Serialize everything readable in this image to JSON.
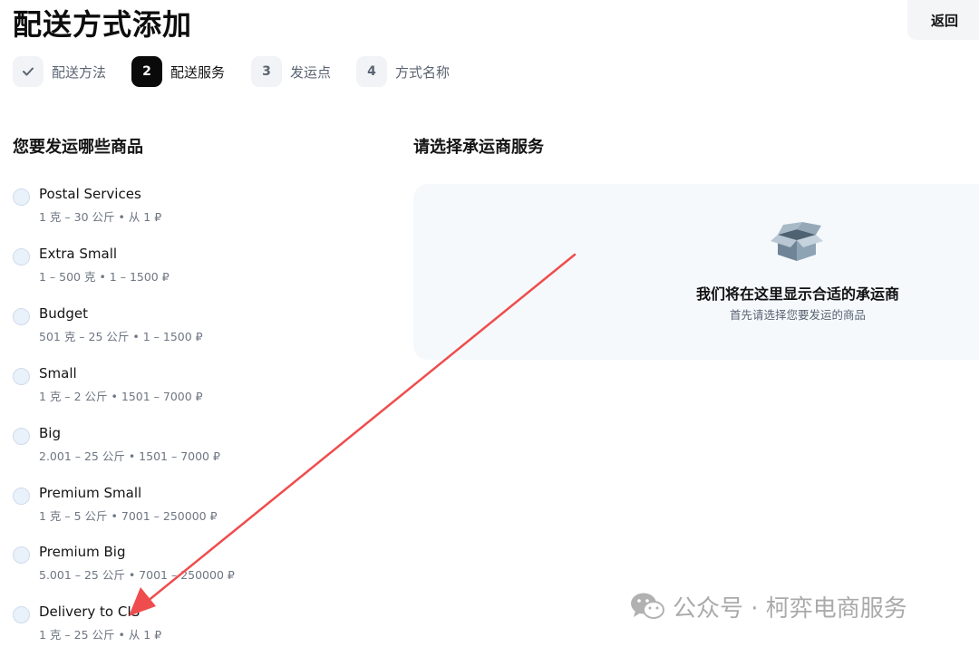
{
  "header": {
    "title": "配送方式添加",
    "back_label": "返回"
  },
  "steps": [
    {
      "badge": "✓",
      "label": "配送方法",
      "state": "done"
    },
    {
      "badge": "2",
      "label": "配送服务",
      "state": "active"
    },
    {
      "badge": "3",
      "label": "发运点",
      "state": "pending"
    },
    {
      "badge": "4",
      "label": "方式名称",
      "state": "pending"
    }
  ],
  "products": {
    "title": "您要发运哪些商品",
    "items": [
      {
        "name": "Postal Services",
        "meta": "1 克 – 30 公斤 • 从 1 ₽"
      },
      {
        "name": "Extra Small",
        "meta": "1 – 500 克 • 1 – 1500 ₽"
      },
      {
        "name": "Budget",
        "meta": "501 克 – 25 公斤 • 1 – 1500 ₽"
      },
      {
        "name": "Small",
        "meta": "1 克 – 2 公斤 • 1501 – 7000 ₽"
      },
      {
        "name": "Big",
        "meta": "2.001 – 25 公斤 • 1501 – 7000 ₽"
      },
      {
        "name": "Premium Small",
        "meta": "1 克 – 5 公斤 • 7001 – 250000 ₽"
      },
      {
        "name": "Premium Big",
        "meta": "5.001 – 25 公斤 • 7001 – 250000 ₽"
      },
      {
        "name": "Delivery to CIS",
        "meta": "1 克 – 25 公斤 • 从 1 ₽"
      }
    ]
  },
  "carrier": {
    "title": "请选择承运商服务",
    "empty_title": "我们将在这里显示合适的承运商",
    "empty_subtitle": "首先请选择您要发运的商品"
  },
  "watermark": {
    "text": "公众号 · 柯弈电商服务"
  },
  "colors": {
    "accent": "#0a0a0a",
    "radio_fill": "#e9f1fa",
    "panel_bg": "#f5f9fc",
    "annotation_arrow": "#ef4d4d"
  }
}
